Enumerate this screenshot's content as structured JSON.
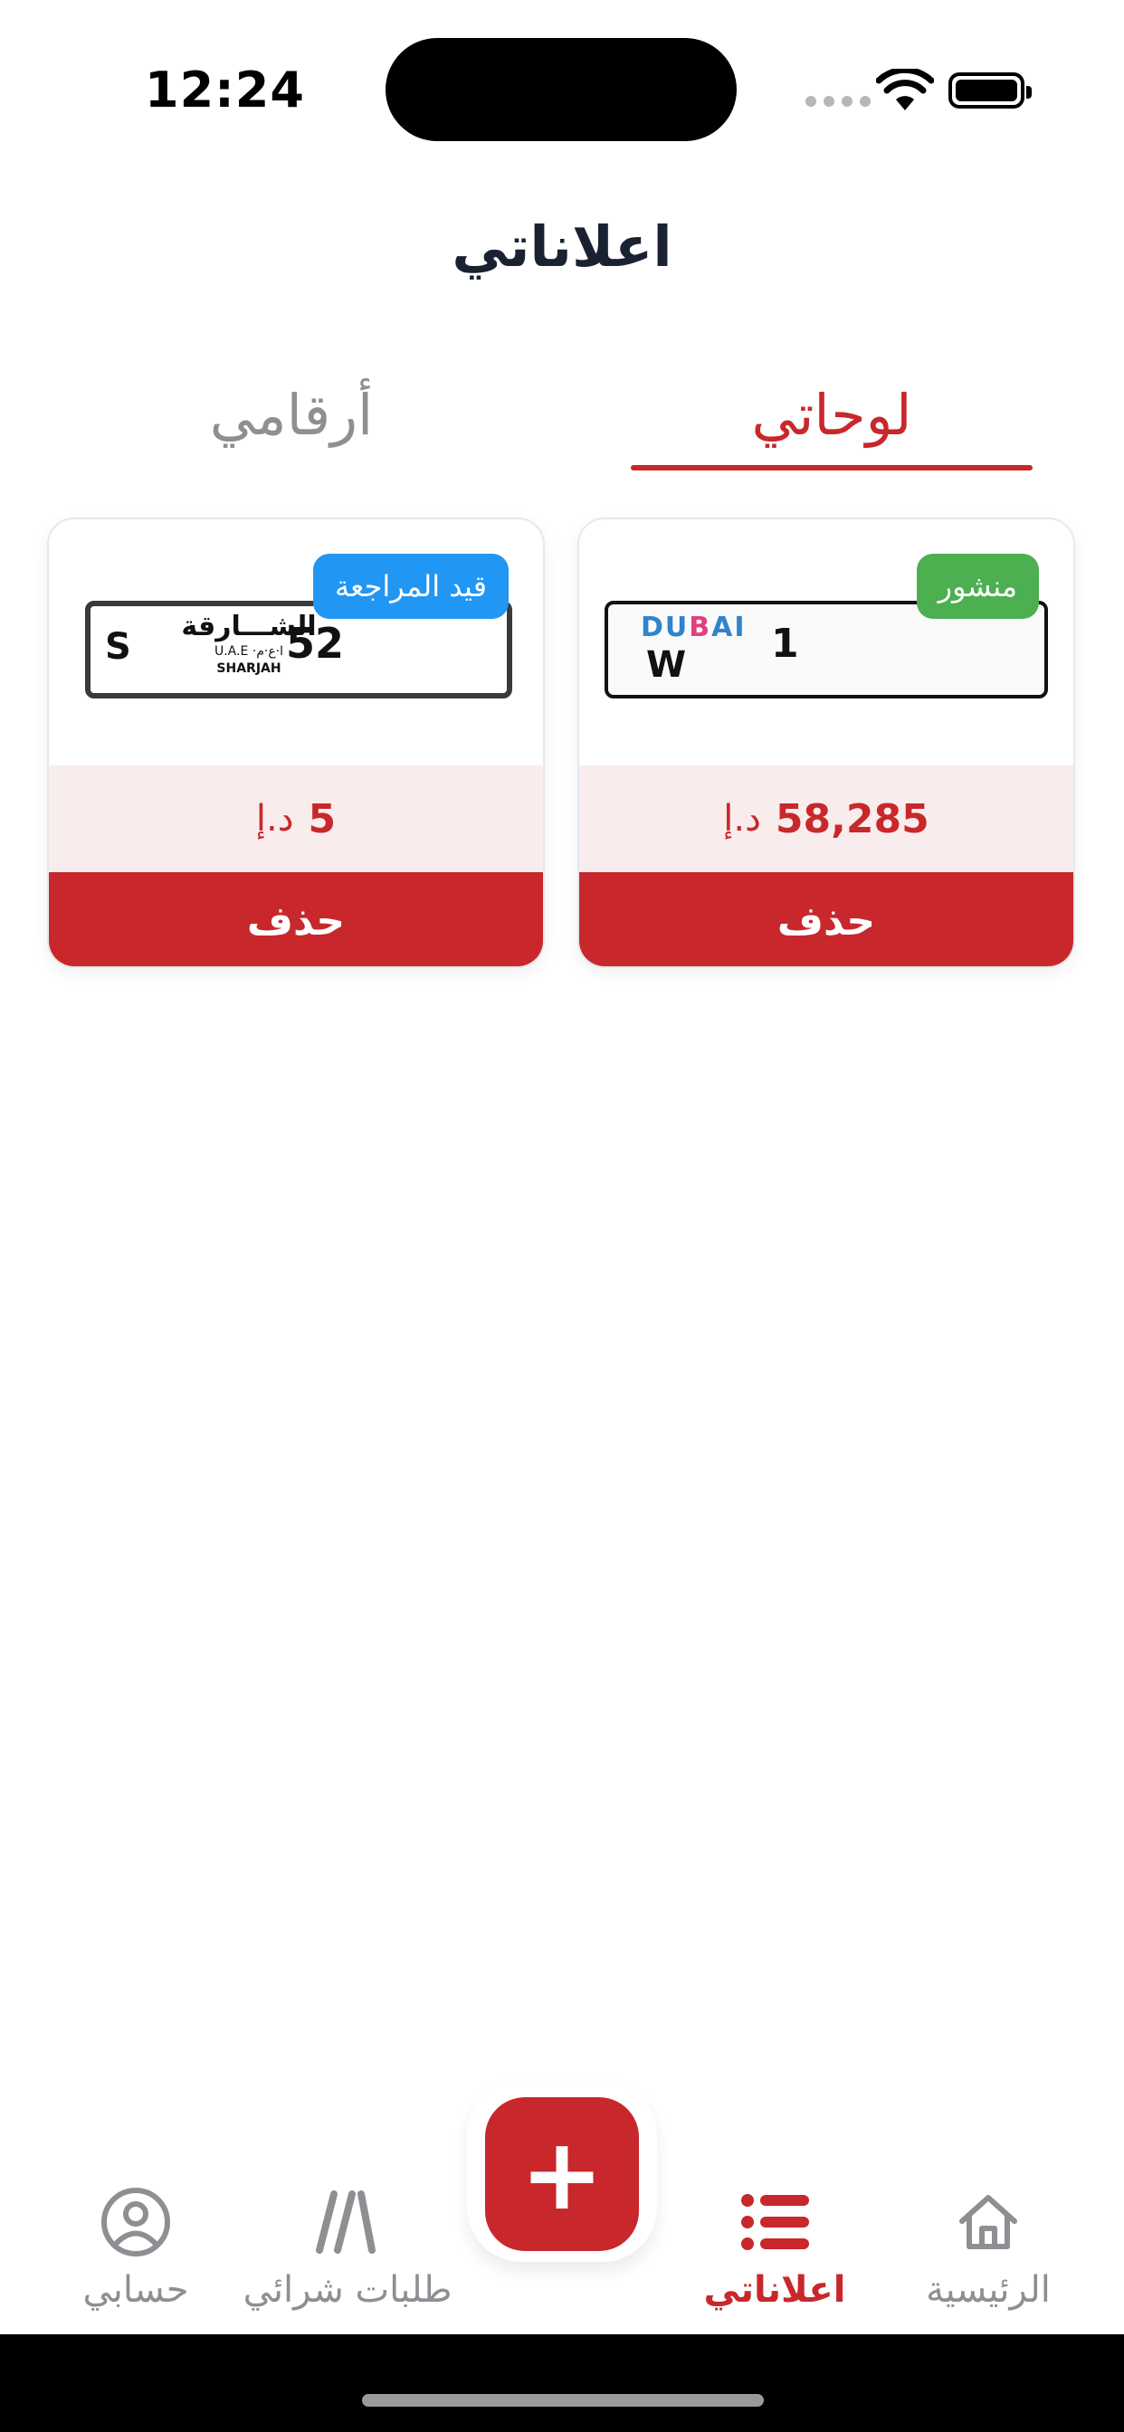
{
  "status_bar": {
    "time": "12:24"
  },
  "header": {
    "title": "اعلاناتي"
  },
  "tabs": [
    {
      "label": "لوحاتي",
      "active": true
    },
    {
      "label": "أرقامي",
      "active": false
    }
  ],
  "listings": [
    {
      "status": "منشور",
      "status_color": "#4caf50",
      "plate": {
        "emirate_logo": "DUBAI",
        "code": "W",
        "number": "1"
      },
      "price": "58,285",
      "currency": "د.إ",
      "delete_label": "حذف"
    },
    {
      "status": "قيد المراجعة",
      "status_color": "#2196f3",
      "plate": {
        "code": "S",
        "emirate_ar": "الشـــارقة",
        "country": "U.A.E ·ا·ع·م",
        "emirate_en": "SHARJAH",
        "number": "52"
      },
      "price": "5",
      "currency": "د.إ",
      "delete_label": "حذف"
    }
  ],
  "bottom_nav": {
    "items": [
      {
        "label": "الرئيسية",
        "icon": "home-icon",
        "active": false
      },
      {
        "label": "اعلاناتي",
        "icon": "list-icon",
        "active": true
      },
      {
        "label": "طلبات شرائي",
        "icon": "slashes-icon",
        "active": false
      },
      {
        "label": "حسابي",
        "icon": "user-circle-icon",
        "active": false
      }
    ],
    "fab_icon": "plus-icon",
    "fab_symbol": "+"
  },
  "colors": {
    "accent": "#c8282b",
    "price_bg": "#f9ecec",
    "published": "#4caf50",
    "review": "#2196f3"
  }
}
